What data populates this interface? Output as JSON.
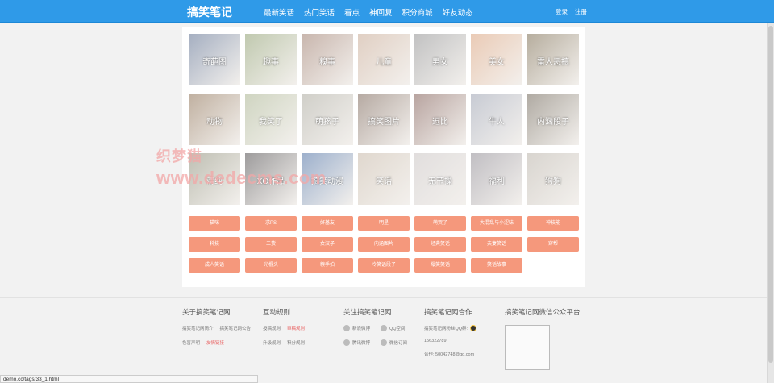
{
  "header": {
    "logo": "搞笑笔记",
    "nav": [
      "最新笑话",
      "热门笑话",
      "看点",
      "神回复",
      "积分商城",
      "好友动态"
    ],
    "login": "登录",
    "register": "注册"
  },
  "tiles": [
    {
      "label": "奇葩图",
      "color": "#5b6d8e"
    },
    {
      "label": "趣事",
      "color": "#8d9d6e"
    },
    {
      "label": "糗事",
      "color": "#9c7a6a"
    },
    {
      "label": "儿童",
      "color": "#c7a892"
    },
    {
      "label": "男女",
      "color": "#8f8f90"
    },
    {
      "label": "美女",
      "color": "#d9a07a"
    },
    {
      "label": "雷人恶搞",
      "color": "#7b6b4f"
    },
    {
      "label": "动物",
      "color": "#8c6f52"
    },
    {
      "label": "我笑了",
      "color": "#a8b28e"
    },
    {
      "label": "萌孩子",
      "color": "#a9a79c"
    },
    {
      "label": "搞笑图片",
      "color": "#7a6456"
    },
    {
      "label": "逗比",
      "color": "#7e5a52"
    },
    {
      "label": "牛人",
      "color": "#9aa0b0"
    },
    {
      "label": "内涵段子",
      "color": "#6f6557"
    },
    {
      "label": "清纯",
      "color": "#8a8a74"
    },
    {
      "label": "XO作品",
      "color": "#4e4b4c"
    },
    {
      "label": "搞笑动漫",
      "color": "#4c6fa3"
    },
    {
      "label": "笑话",
      "color": "#c6b7a6"
    },
    {
      "label": "无节操",
      "color": "#c9c3c2"
    },
    {
      "label": "福利",
      "color": "#8e8a92"
    },
    {
      "label": "狗狗",
      "color": "#b9b2a8"
    }
  ],
  "tags": [
    "猫咪",
    "求PS",
    "好基友",
    "明星",
    "萌哭了",
    "大混乱与小涩味",
    "神技能",
    "科技",
    "二货",
    "女汉子",
    "内涵图片",
    "经典笑话",
    "夫妻笑话",
    "穿帮",
    "成人笑话",
    "光棍头",
    "糗手拍",
    "冷笑话段子",
    "爆笑笑话",
    "笑话故事"
  ],
  "watermark": {
    "cn": "织梦猫",
    "url": "www.dedecms.com"
  },
  "footer": {
    "about": {
      "title": "关于搞笑笔记网",
      "links": [
        "搞笑笔记网简介",
        "搞笑笔记网公告",
        "色盲声明",
        "友情链接"
      ]
    },
    "rules": {
      "title": "互动规则",
      "links": [
        "投稿规则",
        "审稿规则",
        "升级规则",
        "积分规则"
      ]
    },
    "follow": {
      "title": "关注搞笑笔记网",
      "links": [
        "新浪微博",
        "QQ空间",
        "腾讯微博",
        "微信订阅"
      ]
    },
    "coop": {
      "title": "搞笑笔记网合作",
      "lines": [
        "搞笑笔记网粉丝QQ群:",
        "156322789",
        "合作: 50042748@qq.com"
      ]
    },
    "wechat": {
      "title": "搞笑笔记网微信公众平台"
    }
  },
  "status_url": "demo.cc/tags/33_1.html"
}
